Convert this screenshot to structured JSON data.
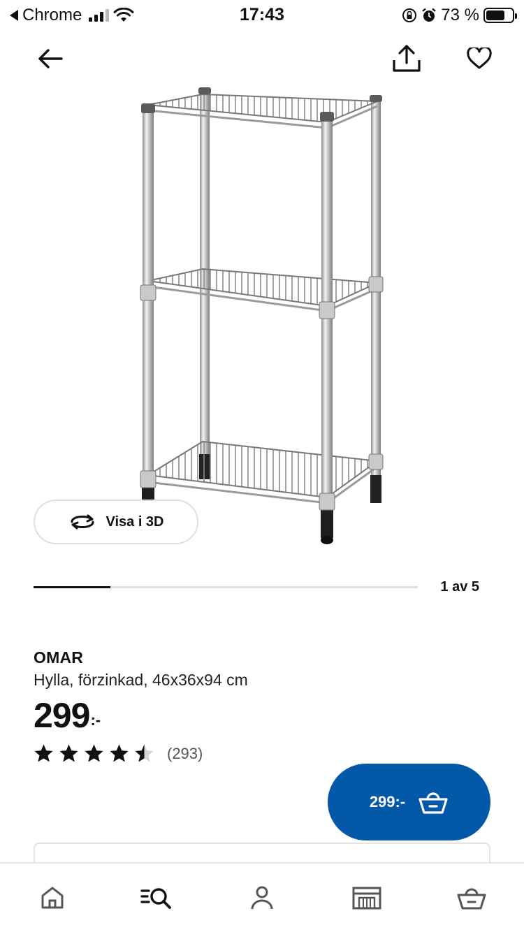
{
  "status_bar": {
    "back_app": "Chrome",
    "time": "17:43",
    "battery": "73 %",
    "battery_level": 0.73
  },
  "toolbar": {
    "back_icon": "arrow-left-icon",
    "share_icon": "share-icon",
    "favorite_icon": "heart-icon"
  },
  "gallery": {
    "view3d_label": "Visa i 3D",
    "position_text": "1 av 5",
    "current_index": 1,
    "total": 5
  },
  "product": {
    "name": "OMAR",
    "description": "Hylla, förzinkad, 46x36x94 cm",
    "price": "299",
    "price_suffix": ":-",
    "rating": 4.5,
    "review_count": "(293)"
  },
  "cart_button": {
    "label": "299:-",
    "icon": "basket-icon",
    "color": "#0358a7"
  },
  "bottom_nav": {
    "items": [
      {
        "icon": "home-icon"
      },
      {
        "icon": "search-browse-icon"
      },
      {
        "icon": "profile-icon"
      },
      {
        "icon": "store-icon"
      },
      {
        "icon": "cart-icon"
      }
    ]
  }
}
